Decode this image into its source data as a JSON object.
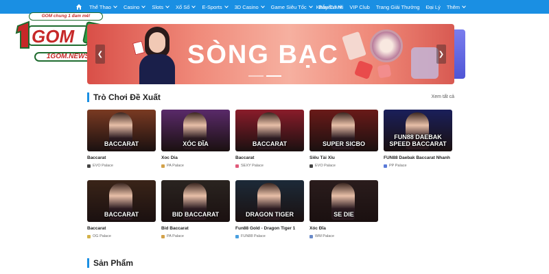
{
  "nav": {
    "left_items": [
      {
        "label": "Thể Thao",
        "has_dropdown": true
      },
      {
        "label": "Casino",
        "has_dropdown": true
      },
      {
        "label": "Slots",
        "has_dropdown": true
      },
      {
        "label": "Xổ Số",
        "has_dropdown": true
      },
      {
        "label": "E-Sports",
        "has_dropdown": true
      },
      {
        "label": "3D Casino",
        "has_dropdown": true
      },
      {
        "label": "Game Siêu Tốc",
        "has_dropdown": true
      },
      {
        "label": "Bắn Cá",
        "has_dropdown": true
      }
    ],
    "right_items": [
      {
        "label": "Khuyến Mãi",
        "has_dropdown": false
      },
      {
        "label": "VIP Club",
        "has_dropdown": false
      },
      {
        "label": "Trang Giải Thưởng",
        "has_dropdown": false
      },
      {
        "label": "Đại Lý",
        "has_dropdown": false
      },
      {
        "label": "Thêm",
        "has_dropdown": true
      }
    ],
    "home_icon": "home-icon",
    "bg_color": "#1a8fe3"
  },
  "logo": {
    "tagline": "GOM chung 1 đam mê!",
    "brand": "GOM",
    "domain": "1GOM.NEWS"
  },
  "banner": {
    "title": "SÒNG BẠC",
    "prev_icon": "chevron-left-icon",
    "next_icon": "chevron-right-icon",
    "slide_count": 2,
    "active_slide": 2
  },
  "recommended": {
    "title": "Trò Chơi Đề Xuất",
    "see_all": "Xem tất cả",
    "games": [
      {
        "name": "Baccarat",
        "provider": "EVO Palace",
        "thumb_label": "BACCARAT",
        "bg": "#7a3a22",
        "provider_color": "#444444"
      },
      {
        "name": "Xoc Dia",
        "provider": "PA Palace",
        "thumb_label": "XÓC ĐĨA",
        "bg": "#5a2a6a",
        "provider_color": "#d3a24a"
      },
      {
        "name": "Baccarat",
        "provider": "SEXY Palace",
        "thumb_label": "BACCARAT",
        "bg": "#8a1c2a",
        "provider_color": "#e05a7a"
      },
      {
        "name": "Siêu Tài Xỉu",
        "provider": "EVO Palace",
        "thumb_label": "SUPER SICBO",
        "bg": "#6a1a18",
        "provider_color": "#444444"
      },
      {
        "name": "FUN88 Daebak Baccarat Nhanh",
        "provider": "PP Palace",
        "thumb_label": "FUN88 DAEBAK SPEED BACCARAT",
        "bg": "#1a1f5a",
        "provider_color": "#5a7ad8"
      },
      {
        "name": "Baccarat",
        "provider": "OG Palace",
        "thumb_label": "BACCARAT",
        "bg": "#3a2418",
        "provider_color": "#d3b24a"
      },
      {
        "name": "Bid Baccarat",
        "provider": "PA Palace",
        "thumb_label": "BID BACCARAT",
        "bg": "#2a2420",
        "provider_color": "#d3a24a"
      },
      {
        "name": "Fun88 Gold - Dragon Tiger 1",
        "provider": "FUN88 Palace",
        "thumb_label": "DRAGON TIGER",
        "bg": "#1c2a38",
        "provider_color": "#4aa0e0"
      },
      {
        "name": "Xóc Đĩa",
        "provider": "WM Palace",
        "thumb_label": "SE DIE",
        "bg": "#2a1c1c",
        "provider_color": "#6a8ac8"
      }
    ]
  },
  "products": {
    "title": "Sản Phẩm"
  }
}
